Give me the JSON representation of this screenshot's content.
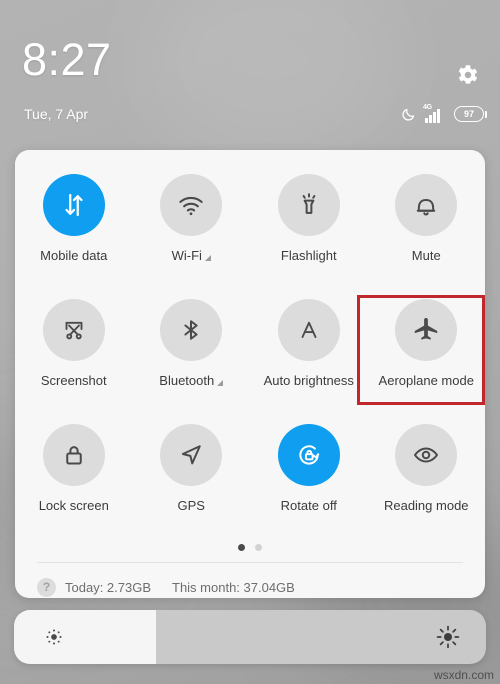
{
  "statusbar": {
    "time": "8:27",
    "date": "Tue, 7 Apr",
    "settings_icon": "gear-icon",
    "dnd_icon": "moon-icon",
    "network_type": "4G",
    "signal_icon": "signal-bars-icon",
    "battery_level": "97"
  },
  "panel": {
    "tiles": [
      [
        {
          "label": "Mobile data",
          "icon": "mobile-data-icon",
          "active": true,
          "has_arrow": false
        },
        {
          "label": "Wi-Fi",
          "icon": "wifi-icon",
          "active": false,
          "has_arrow": true
        },
        {
          "label": "Flashlight",
          "icon": "flashlight-icon",
          "active": false,
          "has_arrow": false
        },
        {
          "label": "Mute",
          "icon": "bell-icon",
          "active": false,
          "has_arrow": false
        }
      ],
      [
        {
          "label": "Screenshot",
          "icon": "screenshot-scissors-icon",
          "active": false,
          "has_arrow": false
        },
        {
          "label": "Bluetooth",
          "icon": "bluetooth-icon",
          "active": false,
          "has_arrow": true
        },
        {
          "label": "Auto brightness",
          "icon": "auto-brightness-a-icon",
          "active": false,
          "has_arrow": false
        },
        {
          "label": "Aeroplane mode",
          "icon": "airplane-icon",
          "active": false,
          "has_arrow": false
        }
      ],
      [
        {
          "label": "Lock screen",
          "icon": "padlock-icon",
          "active": false,
          "has_arrow": false
        },
        {
          "label": "GPS",
          "icon": "navigation-arrow-icon",
          "active": false,
          "has_arrow": false
        },
        {
          "label": "Rotate off",
          "icon": "rotation-lock-icon",
          "active": true,
          "has_arrow": false
        },
        {
          "label": "Reading mode",
          "icon": "eye-icon",
          "active": false,
          "has_arrow": false
        }
      ]
    ],
    "pages": {
      "count": 2,
      "active_index": 0
    },
    "usage": {
      "help_icon_label": "?",
      "today": "Today: 2.73GB",
      "this_month": "This month: 37.04GB"
    }
  },
  "brightness": {
    "low_icon": "small-sun-icon",
    "high_icon": "large-sun-icon",
    "level_percent": 30
  },
  "annotation": {
    "highlight_target": "Aeroplane mode",
    "color": "#c0272d"
  },
  "watermark": "wsxdn.com",
  "colors": {
    "accent_blue": "#0f9ef0",
    "tile_grey": "#dcdcdc",
    "panel_bg": "#f7f7f7"
  }
}
